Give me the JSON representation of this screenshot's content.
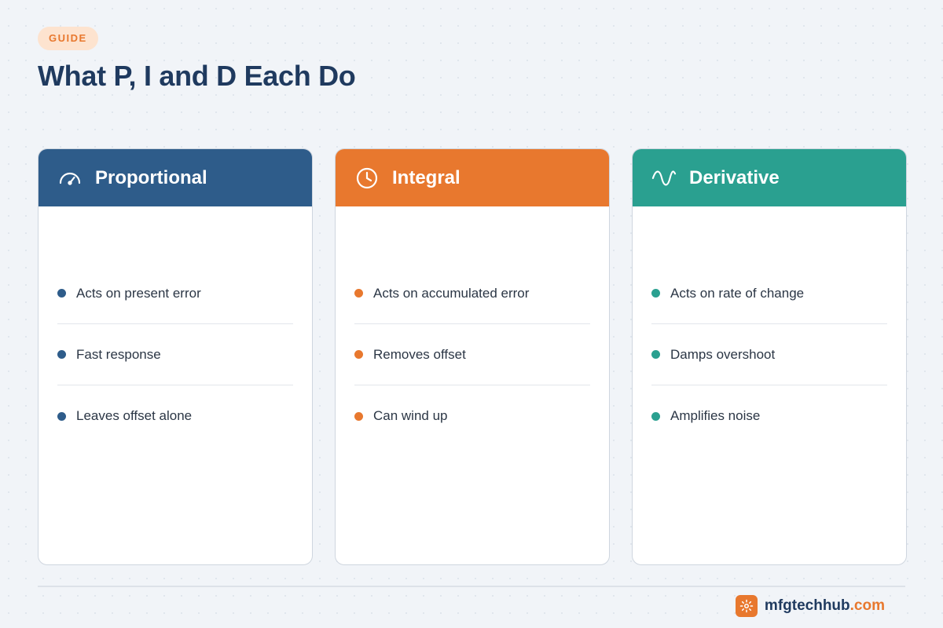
{
  "badge": "GUIDE",
  "title": "What P, I and D Each Do",
  "colors": {
    "p": "#2e5c8a",
    "i": "#e8782e",
    "d": "#2aa090"
  },
  "cards": [
    {
      "title": "Proportional",
      "icon": "gauge-icon",
      "items": [
        "Acts on present error",
        "Fast response",
        "Leaves offset alone"
      ]
    },
    {
      "title": "Integral",
      "icon": "clock-icon",
      "items": [
        "Acts on accumulated error",
        "Removes offset",
        "Can wind up"
      ]
    },
    {
      "title": "Derivative",
      "icon": "wave-icon",
      "items": [
        "Acts on rate of change",
        "Damps overshoot",
        "Amplifies noise"
      ]
    }
  ],
  "footer": {
    "brand_name": "mfgtechhub",
    "brand_tld": ".com",
    "logo_icon": "gear-icon"
  }
}
